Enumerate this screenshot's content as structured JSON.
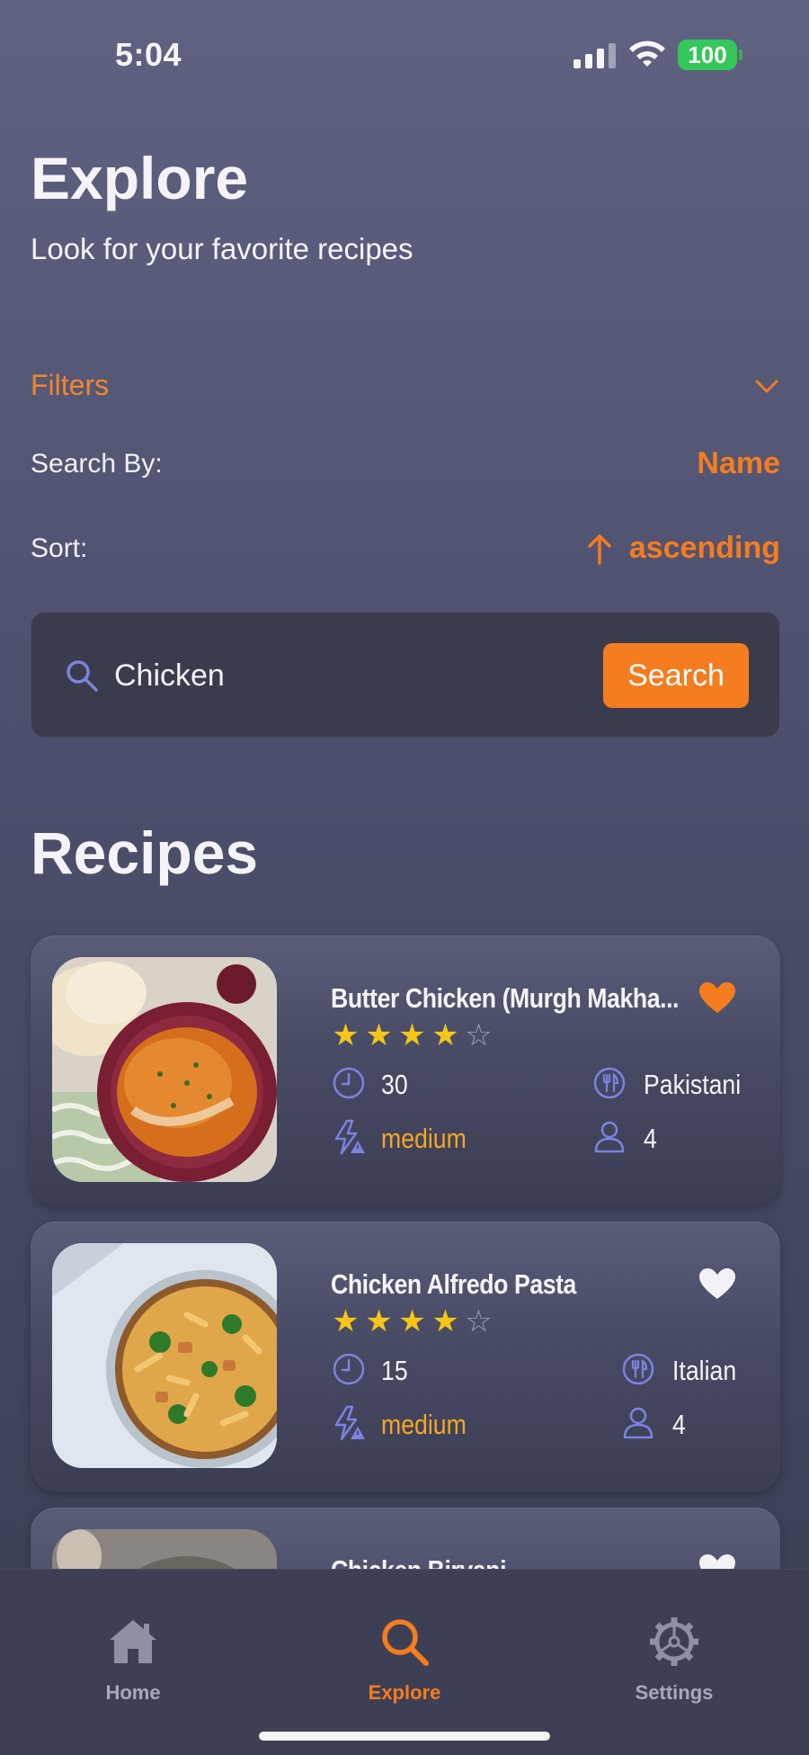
{
  "status_bar": {
    "time": "5:04",
    "battery": "100"
  },
  "header": {
    "title": "Explore",
    "subtitle": "Look for your favorite recipes"
  },
  "filters": {
    "label": "Filters",
    "search_by_label": "Search By:",
    "search_by_value": "Name",
    "sort_label": "Sort:",
    "sort_value": "ascending"
  },
  "search": {
    "value": "Chicken",
    "placeholder": "Search",
    "button_label": "Search"
  },
  "recipes_heading": "Recipes",
  "recipes": [
    {
      "name": "Butter Chicken (Murgh Makha...",
      "rating": 4,
      "time": "30",
      "cuisine": "Pakistani",
      "difficulty": "medium",
      "servings": "4",
      "favorite": true
    },
    {
      "name": "Chicken Alfredo Pasta",
      "rating": 4,
      "time": "15",
      "cuisine": "Italian",
      "difficulty": "medium",
      "servings": "4",
      "favorite": false
    },
    {
      "name": "Chicken Biryani",
      "favorite": false
    }
  ],
  "tab_bar": {
    "tabs": [
      {
        "label": "Home",
        "icon": "house-icon",
        "active": false
      },
      {
        "label": "Explore",
        "icon": "magnifier-icon",
        "active": true
      },
      {
        "label": "Settings",
        "icon": "gear-icon",
        "active": false
      }
    ]
  },
  "colors": {
    "accent": "#f57c1f",
    "star": "#f5c518",
    "icon": "#7b83e0",
    "heart_active": "#f57c1f",
    "heart_inactive": "#f2f2f6"
  }
}
